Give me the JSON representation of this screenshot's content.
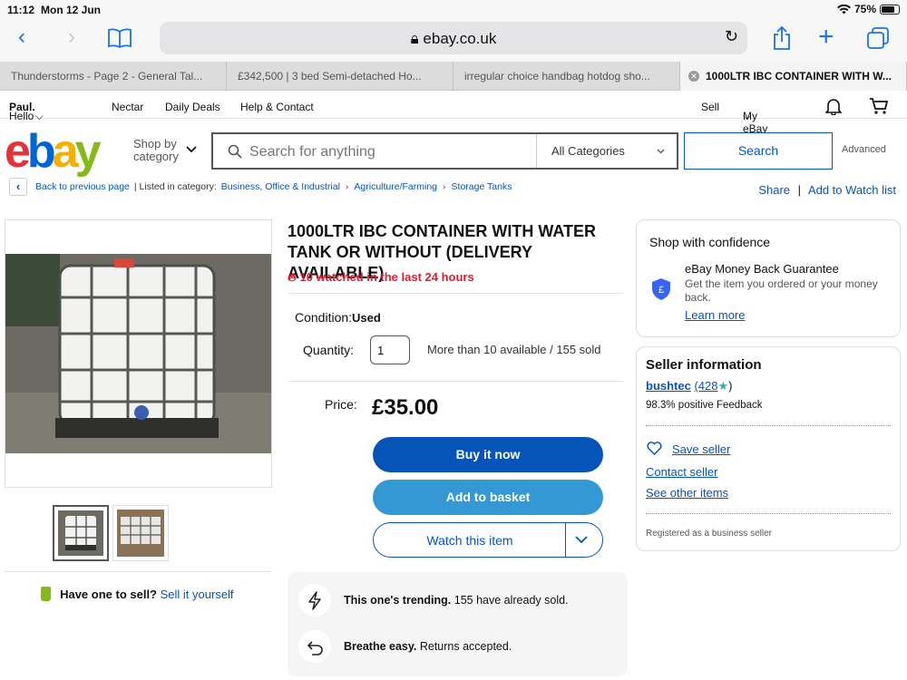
{
  "status_bar": {
    "time": "11:12",
    "date": "Mon 12 Jun",
    "battery": "75%"
  },
  "browser": {
    "url": "ebay.co.uk",
    "tabs": [
      {
        "title": "Thunderstorms - Page 2 - General Tal..."
      },
      {
        "title": "£342,500 | 3 bed Semi-detached Ho..."
      },
      {
        "title": "irregular choice handbag hotdog sho..."
      },
      {
        "title": "1000LTR IBC CONTAINER WITH W...",
        "active": true
      }
    ]
  },
  "top_nav": {
    "greeting": "Hello",
    "user": "Paul.",
    "nectar": "Nectar",
    "daily_deals": "Daily Deals",
    "help": "Help & Contact",
    "sell": "Sell",
    "my_ebay": "My eBay"
  },
  "header": {
    "shop_by": "Shop by",
    "category": "category",
    "search_placeholder": "Search for anything",
    "category_select": "All Categories",
    "search_button": "Search",
    "advanced": "Advanced"
  },
  "breadcrumb": {
    "back": "Back to previous page",
    "listed_in": "| Listed in category:",
    "items": [
      "Business, Office & Industrial",
      "Agriculture/Farming",
      "Storage Tanks"
    ],
    "share": "Share",
    "separator": "|",
    "watchlist": "Add to Watch list"
  },
  "listing": {
    "title": "1000LTR IBC CONTAINER WITH WATER TANK OR WITHOUT (DELIVERY AVAILABLE)",
    "watched": "10 watched in the last 24 hours",
    "condition_label": "Condition:",
    "condition_value": "Used",
    "quantity_label": "Quantity:",
    "quantity_value": "1",
    "availability": "More than 10 available / 155 sold",
    "price_label": "Price:",
    "price": "£35.00",
    "buy_now": "Buy it now",
    "add_to_basket": "Add to basket",
    "watch_item": "Watch this item",
    "trending_bold": "This one's trending.",
    "trending_text": "155 have already sold.",
    "returns_bold": "Breathe easy.",
    "returns_text": "Returns accepted."
  },
  "sell_prompt": {
    "question": "Have one to sell?",
    "link": "Sell it yourself"
  },
  "confidence": {
    "heading": "Shop with confidence",
    "guarantee_title": "eBay Money Back Guarantee",
    "guarantee_text": "Get the item you ordered or your money back.",
    "learn_more": "Learn more"
  },
  "seller": {
    "heading": "Seller information",
    "name": "bushtec",
    "score": "(428",
    "score_close": ")",
    "feedback": "98.3% positive Feedback",
    "save": "Save seller",
    "contact": "Contact seller",
    "other_items": "See other items",
    "registered": "Registered as a business seller"
  },
  "colors": {
    "ebay_blue": "#0654ba",
    "basket_blue": "#3498d4",
    "alert_red": "#dd1e31"
  }
}
